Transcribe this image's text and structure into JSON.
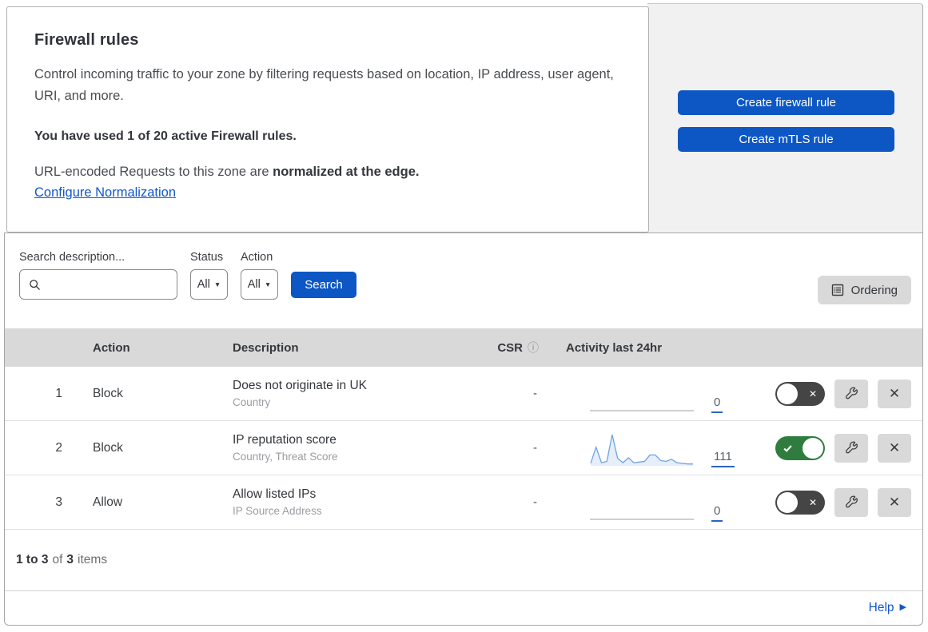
{
  "overview": {
    "title": "Firewall rules",
    "description": "Control incoming traffic to your zone by filtering requests based on location, IP address, user agent, URI, and more.",
    "usage_notice": "You have used 1 of 20 active Firewall rules.",
    "normalization_prefix": "URL-encoded Requests to this zone are",
    "normalization_bold": "normalized at the edge.",
    "normalization_link": "Configure Normalization"
  },
  "actions_panel": {
    "create_firewall_rule_label": "Create firewall rule",
    "create_mtls_rule_label": "Create mTLS rule"
  },
  "filters": {
    "search_label": "Search description...",
    "status_label": "Status",
    "status_value": "All",
    "action_label": "Action",
    "action_value": "All",
    "search_button_label": "Search",
    "ordering_button_label": "Ordering"
  },
  "table": {
    "columns": {
      "action": "Action",
      "description": "Description",
      "csr": "CSR",
      "activity": "Activity last 24hr"
    },
    "rows": [
      {
        "index": "1",
        "action": "Block",
        "description": "Does not originate in UK",
        "match_fields": "Country",
        "csr": "-",
        "activity_count": "0",
        "enabled": false,
        "sparkline": null
      },
      {
        "index": "2",
        "action": "Block",
        "description": "IP reputation score",
        "match_fields": "Country, Threat Score",
        "csr": "-",
        "activity_count": "111",
        "enabled": true,
        "sparkline": [
          8,
          60,
          10,
          14,
          100,
          24,
          10,
          26,
          10,
          12,
          14,
          35,
          35,
          17,
          14,
          21,
          10,
          8,
          6,
          6
        ]
      },
      {
        "index": "3",
        "action": "Allow",
        "description": "Allow listed IPs",
        "match_fields": "IP Source Address",
        "csr": "-",
        "activity_count": "0",
        "enabled": false,
        "sparkline": null
      }
    ]
  },
  "footer": {
    "range": "1 to 3",
    "of_word": "of",
    "total": "3",
    "items_word": "items"
  },
  "help": {
    "label": "Help"
  },
  "icons": {
    "search": "magnifier-glyph",
    "caret_down": "▼",
    "ordering": "list-page-glyph",
    "info": "ⓘ",
    "toggle_off_x": "✕",
    "toggle_on_check": "✓",
    "wrench": "wrench-glyph",
    "close": "✕",
    "help_arrow": "▶"
  },
  "colors": {
    "primary_blue": "#0d57c4",
    "link_blue": "#1157c9",
    "toggle_on_green": "#2e7d3e",
    "toggle_off_dark": "#454545",
    "table_header_gray": "#d9d9d9",
    "panel_gray": "#f1f1f1",
    "control_gray": "#d9d9d9",
    "sparkline_blue": "#6fa3e3",
    "count_underline_blue": "#2c63c5"
  }
}
